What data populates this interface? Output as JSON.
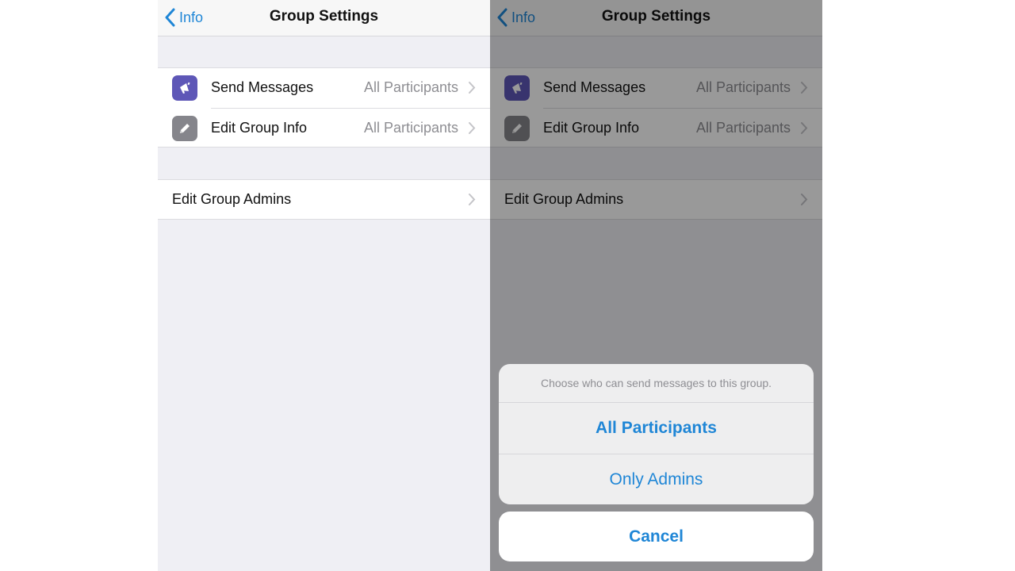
{
  "colors": {
    "accent": "#1f86d6",
    "send_icon_bg": "#5e57b7",
    "edit_icon_bg": "#85858b",
    "background": "#efeff4"
  },
  "screens": [
    {
      "nav": {
        "back_label": "Info",
        "title": "Group Settings"
      },
      "rows": [
        {
          "label": "Send Messages",
          "value": "All Participants",
          "icon": "megaphone-icon"
        },
        {
          "label": "Edit Group Info",
          "value": "All Participants",
          "icon": "pencil-icon"
        }
      ],
      "admins_label": "Edit Group Admins"
    },
    {
      "nav": {
        "back_label": "Info",
        "title": "Group Settings"
      },
      "rows": [
        {
          "label": "Send Messages",
          "value": "All Participants",
          "icon": "megaphone-icon"
        },
        {
          "label": "Edit Group Info",
          "value": "All Participants",
          "icon": "pencil-icon"
        }
      ],
      "admins_label": "Edit Group Admins",
      "action_sheet": {
        "message": "Choose who can send messages to this group.",
        "options": [
          "All Participants",
          "Only Admins"
        ],
        "cancel": "Cancel"
      }
    }
  ]
}
